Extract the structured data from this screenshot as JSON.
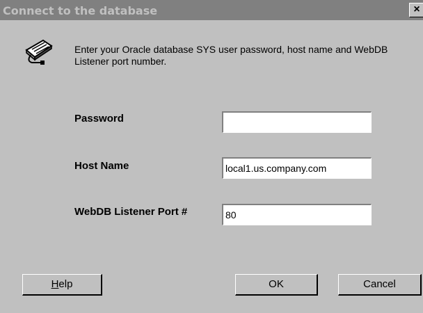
{
  "window": {
    "title": "Connect to the database",
    "close_label": "×"
  },
  "intro": {
    "text": "Enter your Oracle database SYS user password, host name and WebDB Listener port number."
  },
  "form": {
    "password": {
      "label": "Password",
      "value": ""
    },
    "host": {
      "label": "Host Name",
      "value": "local1.us.company.com"
    },
    "port": {
      "label": "WebDB Listener Port #",
      "value": "80"
    }
  },
  "buttons": {
    "help_mnemonic": "H",
    "help_rest": "elp",
    "ok": "OK",
    "cancel": "Cancel"
  },
  "icons": {
    "dialog_icon": "keyboard-plug-icon"
  }
}
